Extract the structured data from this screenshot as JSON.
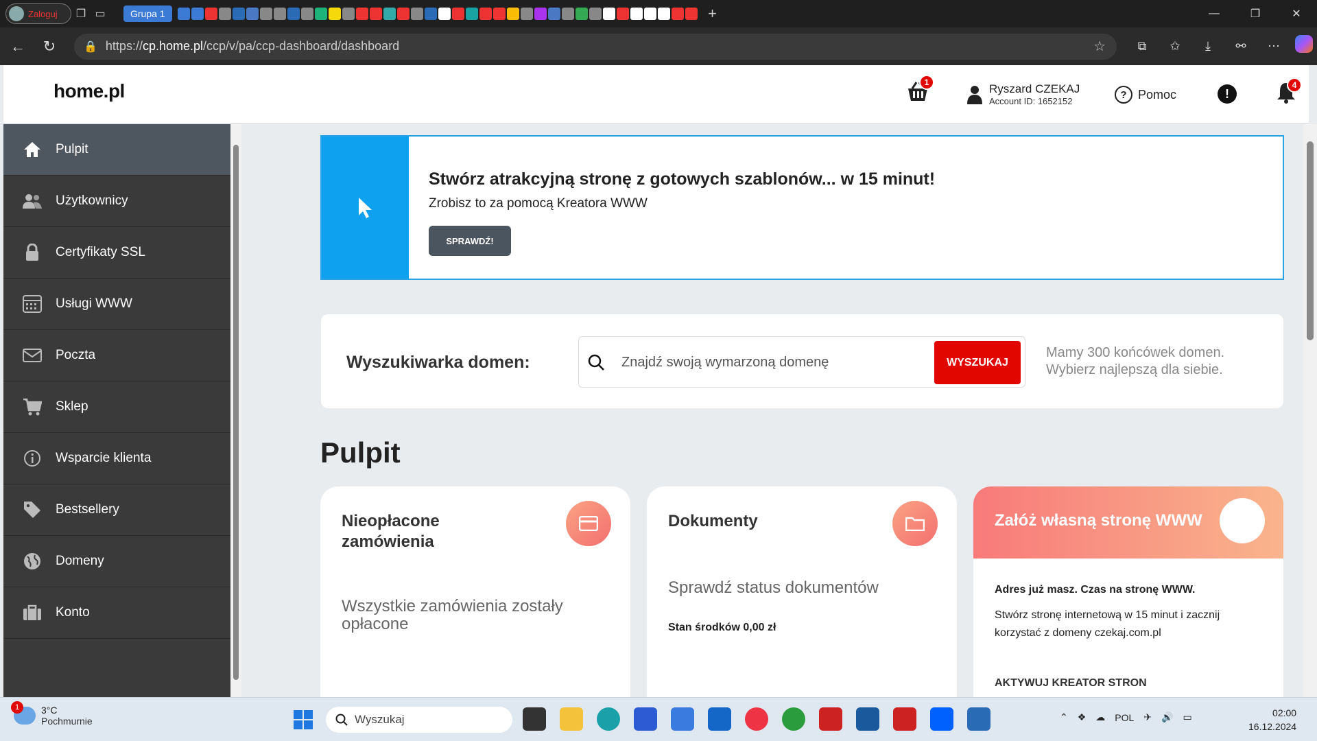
{
  "browser": {
    "profile_label": "Zaloguj",
    "tab_group": "Grupa 1",
    "url_prefix": "https://",
    "url_host": "cp.home.pl",
    "url_path": "/ccp/v/pa/ccp-dashboard/dashboard"
  },
  "header": {
    "logo": "home.pl",
    "cart_badge": "1",
    "user_name": "Ryszard CZEKAJ",
    "account_id": "Account ID: 1652152",
    "help_label": "Pomoc",
    "bell_badge": "4"
  },
  "sidebar": {
    "items": [
      {
        "label": "Pulpit",
        "icon": "home-icon"
      },
      {
        "label": "Użytkownicy",
        "icon": "users-icon"
      },
      {
        "label": "Certyfikaty SSL",
        "icon": "lock-icon"
      },
      {
        "label": "Usługi WWW",
        "icon": "server-icon"
      },
      {
        "label": "Poczta",
        "icon": "mail-icon"
      },
      {
        "label": "Sklep",
        "icon": "cart-icon"
      },
      {
        "label": "Wsparcie klienta",
        "icon": "info-icon"
      },
      {
        "label": "Bestsellery",
        "icon": "tag-icon"
      },
      {
        "label": "Domeny",
        "icon": "globe-icon"
      },
      {
        "label": "Konto",
        "icon": "briefcase-icon"
      }
    ]
  },
  "banner": {
    "title": "Stwórz atrakcyjną stronę z gotowych szablonów... w 15 minut!",
    "subtitle": "Zrobisz to za pomocą Kreatora WWW",
    "button": "SPRAWDŹ!"
  },
  "domain_search": {
    "label": "Wyszukiwarka domen:",
    "placeholder": "Znajdź swoją wymarzoną domenę",
    "button": "WYSZUKAJ",
    "note_line1": "Mamy 300 końcówek domen.",
    "note_line2": "Wybierz najlepszą dla siebie."
  },
  "page_title": "Pulpit",
  "cards": {
    "unpaid": {
      "title_line1": "Nieopłacone",
      "title_line2": "zamówienia",
      "text_line1": "Wszystkie zamówienia zostały",
      "text_line2": "opłacone"
    },
    "documents": {
      "title": "Dokumenty",
      "text": "Sprawdź status dokumentów",
      "balance": "Stan środków 0,00 zł"
    },
    "www": {
      "title": "Załóż własną stronę WWW",
      "line1": "Adres już masz. Czas na stronę WWW.",
      "line2": "Stwórz stronę internetową w 15 minut i zacznij",
      "line3_prefix": "korzystać z domeny ",
      "line3_domain": "czekaj.com.pl",
      "cta": "AKTYWUJ KREATOR STRON"
    }
  },
  "taskbar": {
    "weather_badge": "1",
    "temp": "3°C",
    "weather_desc": "Pochmurnie",
    "search_label": "Wyszukaj",
    "lang": "POL",
    "time": "02:00",
    "date": "16.12.2024"
  },
  "colors": {
    "brand_red": "#e10600",
    "sidebar_bg": "#3a3a3a",
    "banner_blue": "#0ea1ef"
  }
}
